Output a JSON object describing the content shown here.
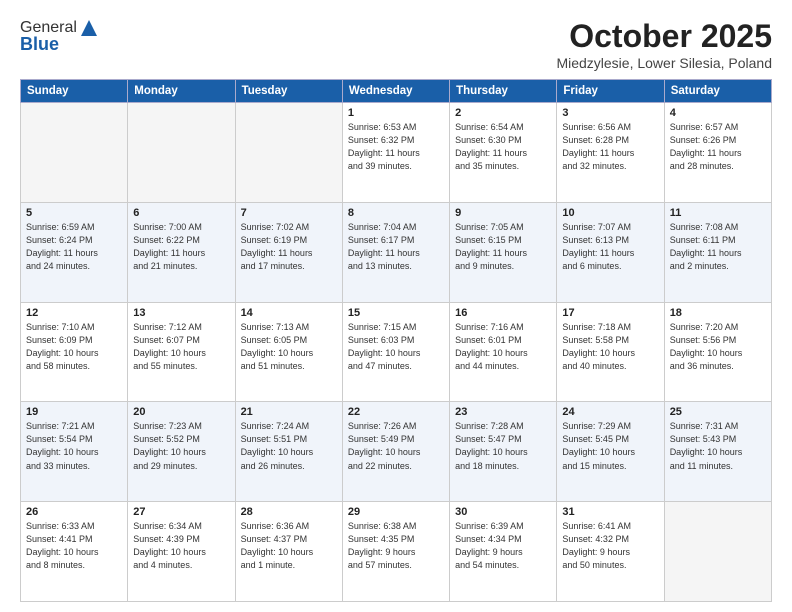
{
  "header": {
    "logo_general": "General",
    "logo_blue": "Blue",
    "month": "October 2025",
    "location": "Miedzylesie, Lower Silesia, Poland"
  },
  "weekdays": [
    "Sunday",
    "Monday",
    "Tuesday",
    "Wednesday",
    "Thursday",
    "Friday",
    "Saturday"
  ],
  "weeks": [
    [
      {
        "day": "",
        "info": ""
      },
      {
        "day": "",
        "info": ""
      },
      {
        "day": "",
        "info": ""
      },
      {
        "day": "1",
        "info": "Sunrise: 6:53 AM\nSunset: 6:32 PM\nDaylight: 11 hours\nand 39 minutes."
      },
      {
        "day": "2",
        "info": "Sunrise: 6:54 AM\nSunset: 6:30 PM\nDaylight: 11 hours\nand 35 minutes."
      },
      {
        "day": "3",
        "info": "Sunrise: 6:56 AM\nSunset: 6:28 PM\nDaylight: 11 hours\nand 32 minutes."
      },
      {
        "day": "4",
        "info": "Sunrise: 6:57 AM\nSunset: 6:26 PM\nDaylight: 11 hours\nand 28 minutes."
      }
    ],
    [
      {
        "day": "5",
        "info": "Sunrise: 6:59 AM\nSunset: 6:24 PM\nDaylight: 11 hours\nand 24 minutes."
      },
      {
        "day": "6",
        "info": "Sunrise: 7:00 AM\nSunset: 6:22 PM\nDaylight: 11 hours\nand 21 minutes."
      },
      {
        "day": "7",
        "info": "Sunrise: 7:02 AM\nSunset: 6:19 PM\nDaylight: 11 hours\nand 17 minutes."
      },
      {
        "day": "8",
        "info": "Sunrise: 7:04 AM\nSunset: 6:17 PM\nDaylight: 11 hours\nand 13 minutes."
      },
      {
        "day": "9",
        "info": "Sunrise: 7:05 AM\nSunset: 6:15 PM\nDaylight: 11 hours\nand 9 minutes."
      },
      {
        "day": "10",
        "info": "Sunrise: 7:07 AM\nSunset: 6:13 PM\nDaylight: 11 hours\nand 6 minutes."
      },
      {
        "day": "11",
        "info": "Sunrise: 7:08 AM\nSunset: 6:11 PM\nDaylight: 11 hours\nand 2 minutes."
      }
    ],
    [
      {
        "day": "12",
        "info": "Sunrise: 7:10 AM\nSunset: 6:09 PM\nDaylight: 10 hours\nand 58 minutes."
      },
      {
        "day": "13",
        "info": "Sunrise: 7:12 AM\nSunset: 6:07 PM\nDaylight: 10 hours\nand 55 minutes."
      },
      {
        "day": "14",
        "info": "Sunrise: 7:13 AM\nSunset: 6:05 PM\nDaylight: 10 hours\nand 51 minutes."
      },
      {
        "day": "15",
        "info": "Sunrise: 7:15 AM\nSunset: 6:03 PM\nDaylight: 10 hours\nand 47 minutes."
      },
      {
        "day": "16",
        "info": "Sunrise: 7:16 AM\nSunset: 6:01 PM\nDaylight: 10 hours\nand 44 minutes."
      },
      {
        "day": "17",
        "info": "Sunrise: 7:18 AM\nSunset: 5:58 PM\nDaylight: 10 hours\nand 40 minutes."
      },
      {
        "day": "18",
        "info": "Sunrise: 7:20 AM\nSunset: 5:56 PM\nDaylight: 10 hours\nand 36 minutes."
      }
    ],
    [
      {
        "day": "19",
        "info": "Sunrise: 7:21 AM\nSunset: 5:54 PM\nDaylight: 10 hours\nand 33 minutes."
      },
      {
        "day": "20",
        "info": "Sunrise: 7:23 AM\nSunset: 5:52 PM\nDaylight: 10 hours\nand 29 minutes."
      },
      {
        "day": "21",
        "info": "Sunrise: 7:24 AM\nSunset: 5:51 PM\nDaylight: 10 hours\nand 26 minutes."
      },
      {
        "day": "22",
        "info": "Sunrise: 7:26 AM\nSunset: 5:49 PM\nDaylight: 10 hours\nand 22 minutes."
      },
      {
        "day": "23",
        "info": "Sunrise: 7:28 AM\nSunset: 5:47 PM\nDaylight: 10 hours\nand 18 minutes."
      },
      {
        "day": "24",
        "info": "Sunrise: 7:29 AM\nSunset: 5:45 PM\nDaylight: 10 hours\nand 15 minutes."
      },
      {
        "day": "25",
        "info": "Sunrise: 7:31 AM\nSunset: 5:43 PM\nDaylight: 10 hours\nand 11 minutes."
      }
    ],
    [
      {
        "day": "26",
        "info": "Sunrise: 6:33 AM\nSunset: 4:41 PM\nDaylight: 10 hours\nand 8 minutes."
      },
      {
        "day": "27",
        "info": "Sunrise: 6:34 AM\nSunset: 4:39 PM\nDaylight: 10 hours\nand 4 minutes."
      },
      {
        "day": "28",
        "info": "Sunrise: 6:36 AM\nSunset: 4:37 PM\nDaylight: 10 hours\nand 1 minute."
      },
      {
        "day": "29",
        "info": "Sunrise: 6:38 AM\nSunset: 4:35 PM\nDaylight: 9 hours\nand 57 minutes."
      },
      {
        "day": "30",
        "info": "Sunrise: 6:39 AM\nSunset: 4:34 PM\nDaylight: 9 hours\nand 54 minutes."
      },
      {
        "day": "31",
        "info": "Sunrise: 6:41 AM\nSunset: 4:32 PM\nDaylight: 9 hours\nand 50 minutes."
      },
      {
        "day": "",
        "info": ""
      }
    ]
  ]
}
